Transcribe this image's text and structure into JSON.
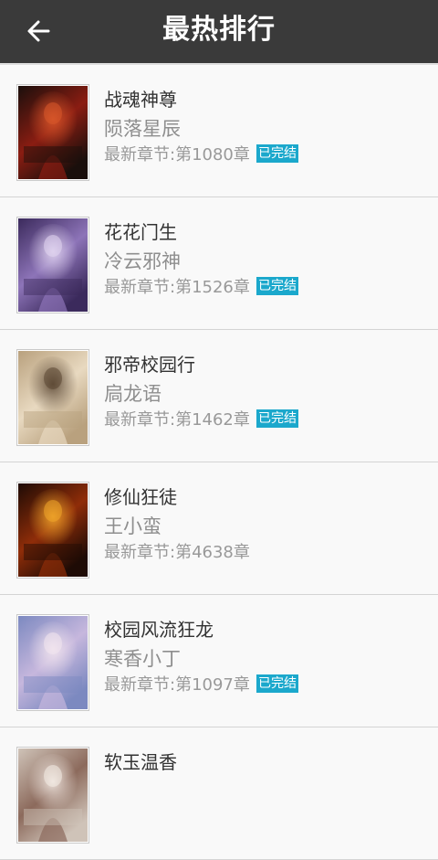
{
  "header": {
    "title": "最热排行",
    "back_icon": "arrow-left-icon",
    "bg_color": "#3a3a3a"
  },
  "books": [
    {
      "name": "战魂神尊",
      "author": "陨落星辰",
      "latest": "最新章节:第1080章",
      "status": "已完结",
      "completed": true,
      "cover_colors": [
        "#1a0f0c",
        "#8a1d12",
        "#d9572a"
      ]
    },
    {
      "name": "花花门生",
      "author": "冷云邪神",
      "latest": "最新章节:第1526章",
      "status": "已完结",
      "completed": true,
      "cover_colors": [
        "#3b2a5c",
        "#8d74b8",
        "#e2d6f0"
      ]
    },
    {
      "name": "邪帝校园行",
      "author": "扃龙语",
      "latest": "最新章节:第1462章",
      "status": "已完结",
      "completed": true,
      "cover_colors": [
        "#b9a17e",
        "#e8d9c0",
        "#5a4632"
      ]
    },
    {
      "name": "修仙狂徒",
      "author": "王小蛮",
      "latest": "最新章节:第4638章",
      "status": "",
      "completed": false,
      "cover_colors": [
        "#1e0b05",
        "#8f2d09",
        "#f0a52a"
      ]
    },
    {
      "name": "校园风流狂龙",
      "author": "寒香小丁",
      "latest": "最新章节:第1097章",
      "status": "已完结",
      "completed": true,
      "cover_colors": [
        "#7c89c0",
        "#c6b7dd",
        "#f2e6ee"
      ]
    },
    {
      "name": "软玉温香",
      "author": "",
      "latest": "",
      "status": "",
      "completed": false,
      "cover_colors": [
        "#cfc3b8",
        "#8c6a5c",
        "#f4ece6"
      ]
    }
  ],
  "accent_color": "#1ba8cc"
}
